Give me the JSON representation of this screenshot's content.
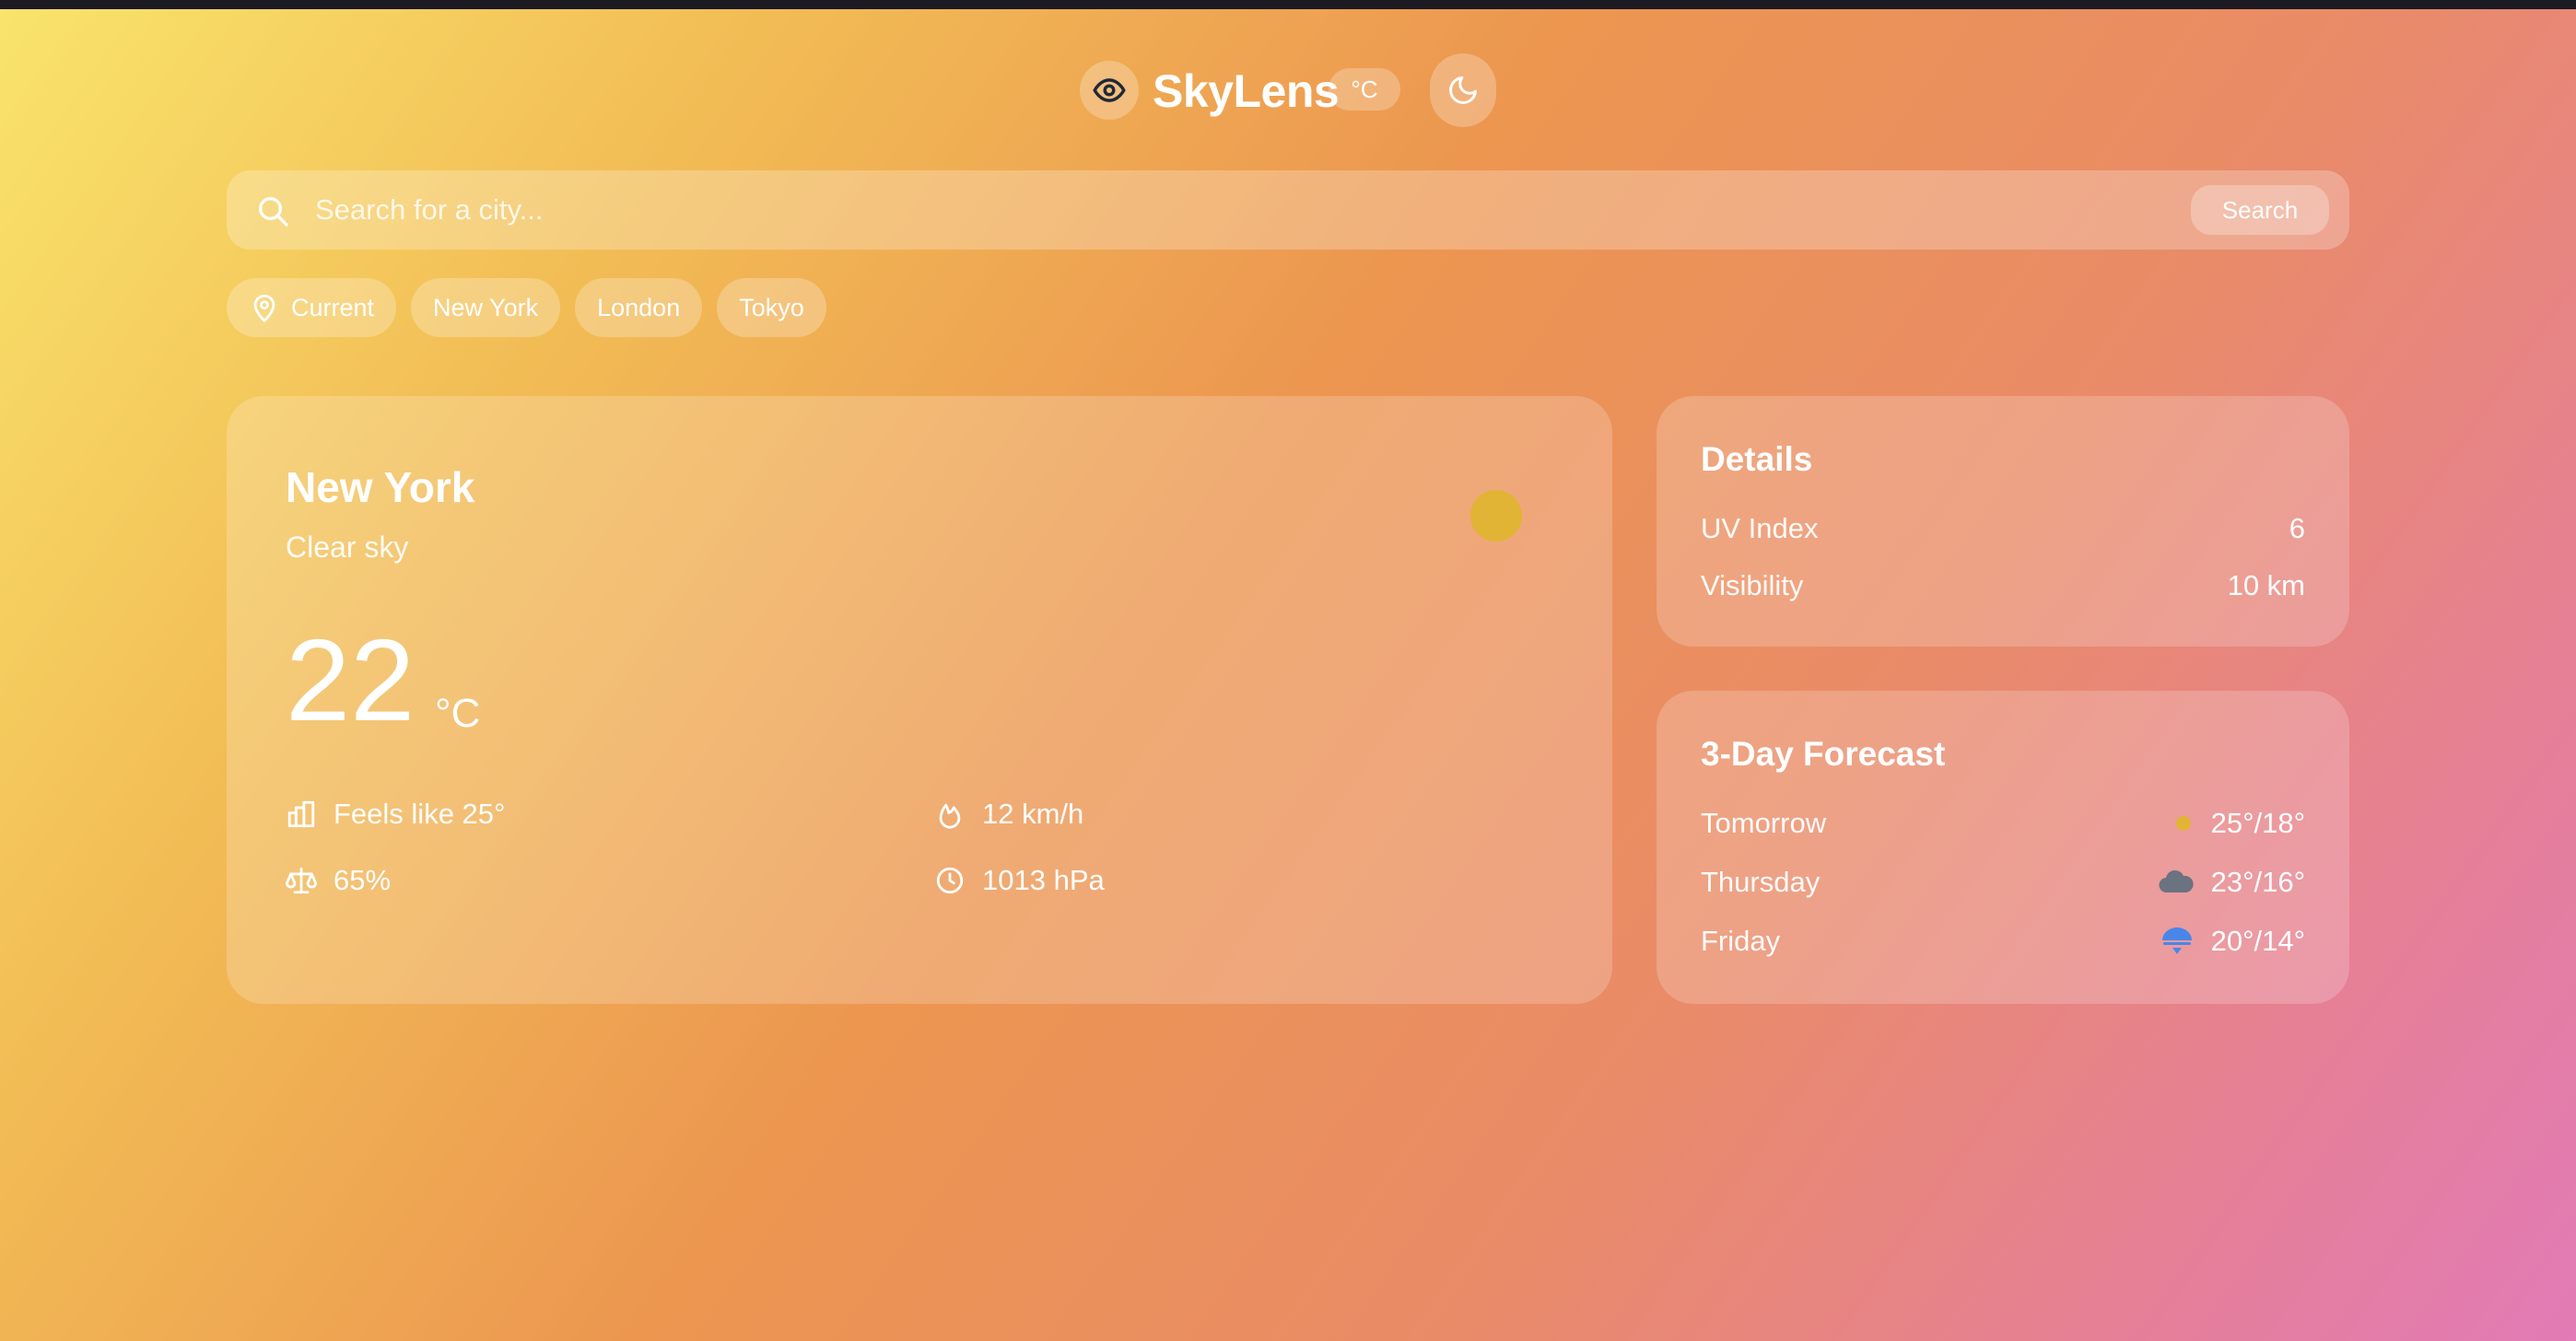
{
  "app": {
    "brand": "SkyLens",
    "unit_toggle": "°C"
  },
  "search": {
    "placeholder": "Search for a city...",
    "button_label": "Search"
  },
  "chips": [
    "Current",
    "New York",
    "London",
    "Tokyo"
  ],
  "current": {
    "city": "New York",
    "condition": "Clear sky",
    "temperature": "22",
    "unit": "°C",
    "feels_like": "Feels like 25°",
    "wind": "12 km/h",
    "humidity": "65%",
    "pressure": "1013 hPa"
  },
  "details": {
    "title": "Details",
    "rows": [
      {
        "label": "UV Index",
        "value": "6"
      },
      {
        "label": "Visibility",
        "value": "10 km"
      }
    ]
  },
  "forecast": {
    "title": "3-Day Forecast",
    "days": [
      {
        "day": "Tomorrow",
        "temps": "25°/18°",
        "icon": "sun-icon"
      },
      {
        "day": "Thursday",
        "temps": "23°/16°",
        "icon": "cloud-icon"
      },
      {
        "day": "Friday",
        "temps": "20°/14°",
        "icon": "rain-icon"
      }
    ]
  },
  "colors": {
    "sun": "#e2b435",
    "cloud": "#6b7280",
    "rain": "#4a86e8"
  }
}
